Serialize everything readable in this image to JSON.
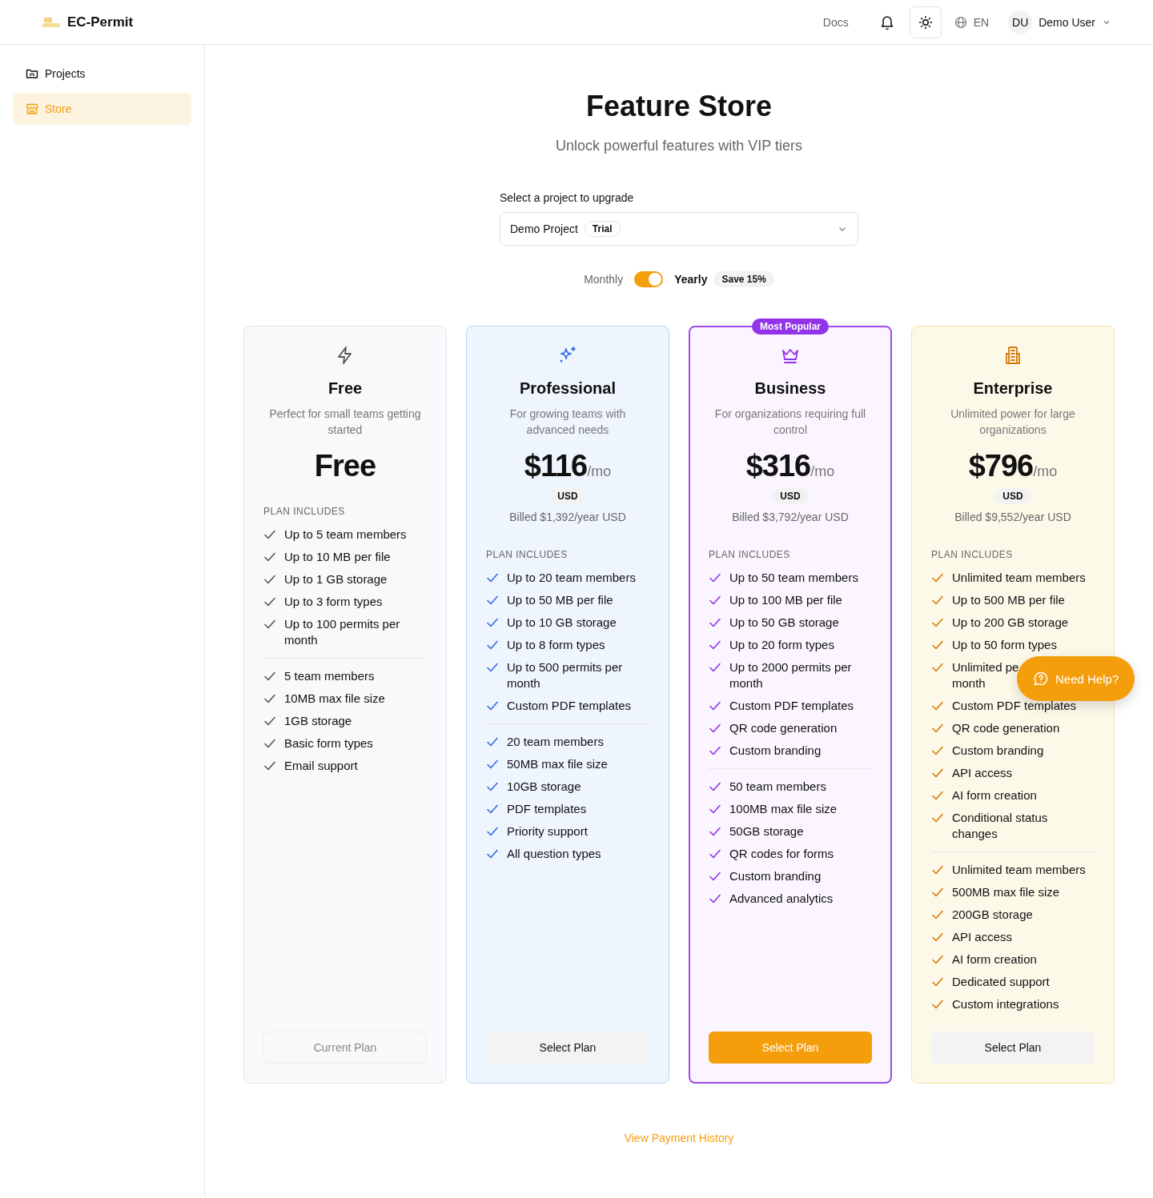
{
  "header": {
    "app_name": "EC-Permit",
    "docs": "Docs",
    "language": "EN",
    "user": {
      "initials": "DU",
      "name": "Demo User"
    }
  },
  "sidebar": {
    "items": [
      {
        "label": "Projects",
        "kind": "folder",
        "selected": false
      },
      {
        "label": "Store",
        "kind": "store",
        "selected": true
      }
    ]
  },
  "page": {
    "title": "Feature Store",
    "subtitle": "Unlock powerful features with VIP tiers"
  },
  "project_select": {
    "label": "Select a project to upgrade",
    "value": "Demo Project",
    "badge": "Trial"
  },
  "billing": {
    "options": [
      {
        "label": "Monthly",
        "selected": false
      },
      {
        "label": "Yearly",
        "selected": true
      }
    ],
    "on": true,
    "badge": "Save 15%"
  },
  "plans": [
    {
      "kind": "free",
      "name": "Free",
      "description": "Perfect for small teams getting started",
      "price": "Free",
      "includes_label": "PLAN INCLUDES",
      "features": [
        {
          "lines": [
            "Up to 5 team members"
          ]
        },
        {
          "lines": [
            "Up to 10 MB per file"
          ]
        },
        {
          "lines": [
            "Up to 1 GB storage"
          ]
        },
        {
          "lines": [
            "Up to 3 form types"
          ]
        },
        {
          "lines": [
            "Up to 100 permits per month"
          ]
        }
      ],
      "extras": [
        "5 team members",
        "10MB max file size",
        "1GB storage",
        "Basic form types",
        "Email support"
      ],
      "button": {
        "label": "Current Plan",
        "disabled": true
      }
    },
    {
      "kind": "professional",
      "name": "Professional",
      "description": "For growing teams with advanced needs",
      "price": "$116",
      "period": "/mo",
      "currency": "USD",
      "billed": "Billed $1,392/year USD",
      "includes_label": "PLAN INCLUDES",
      "features": [
        {
          "lines": [
            "Up to 20 team members"
          ]
        },
        {
          "lines": [
            "Up to 50 MB per file"
          ]
        },
        {
          "lines": [
            "Up to 10 GB storage"
          ]
        },
        {
          "lines": [
            "Up to 8 form types"
          ]
        },
        {
          "lines": [
            "Up to 500 permits per month"
          ]
        },
        {
          "lines": [
            "Custom PDF templates"
          ]
        }
      ],
      "extras": [
        "20 team members",
        "50MB max file size",
        "10GB storage",
        "PDF templates",
        "Priority support",
        "All question types"
      ],
      "button": {
        "label": "Select Plan",
        "disabled": false
      }
    },
    {
      "kind": "business",
      "badge": "Most Popular",
      "name": "Business",
      "description": "For organizations requiring full control",
      "price": "$316",
      "period": "/mo",
      "currency": "USD",
      "billed": "Billed $3,792/year USD",
      "includes_label": "PLAN INCLUDES",
      "features": [
        {
          "lines": [
            "Up to 50 team members"
          ]
        },
        {
          "lines": [
            "Up to 100 MB per file"
          ]
        },
        {
          "lines": [
            "Up to 50 GB storage"
          ]
        },
        {
          "lines": [
            "Up to 20 form types"
          ]
        },
        {
          "lines": [
            "Up to 2000 permits per month"
          ]
        },
        {
          "lines": [
            "Custom PDF templates"
          ]
        },
        {
          "lines": [
            "QR code generation"
          ]
        },
        {
          "lines": [
            "Custom branding"
          ]
        }
      ],
      "extras": [
        "50 team members",
        "100MB max file size",
        "50GB storage",
        "QR codes for forms",
        "Custom branding",
        "Advanced analytics"
      ],
      "button": {
        "label": "Select Plan",
        "disabled": false
      }
    },
    {
      "kind": "enterprise",
      "name": "Enterprise",
      "description": "Unlimited power for large organizations",
      "price": "$796",
      "period": "/mo",
      "currency": "USD",
      "billed": "Billed $9,552/year USD",
      "includes_label": "PLAN INCLUDES",
      "features": [
        {
          "lines": [
            "Unlimited team members"
          ]
        },
        {
          "lines": [
            "Up to 500 MB per file"
          ]
        },
        {
          "lines": [
            "Up to 200 GB storage"
          ]
        },
        {
          "lines": [
            "Up to 50 form types"
          ]
        },
        {
          "lines": [
            "Unlimited pe",
            "month"
          ]
        },
        {
          "lines": [
            "Custom PDF templates"
          ]
        },
        {
          "lines": [
            "QR code generation"
          ]
        },
        {
          "lines": [
            "Custom branding"
          ]
        },
        {
          "lines": [
            "API access"
          ]
        },
        {
          "lines": [
            "AI form creation"
          ]
        },
        {
          "lines": [
            "Conditional status changes"
          ]
        }
      ],
      "extras": [
        "Unlimited team members",
        "500MB max file size",
        "200GB storage",
        "API access",
        "AI form creation",
        "Dedicated support",
        "Custom integrations"
      ],
      "button": {
        "label": "Select Plan",
        "disabled": false
      }
    }
  ],
  "footer_link": "View Payment History",
  "help_button": "Need Help?"
}
